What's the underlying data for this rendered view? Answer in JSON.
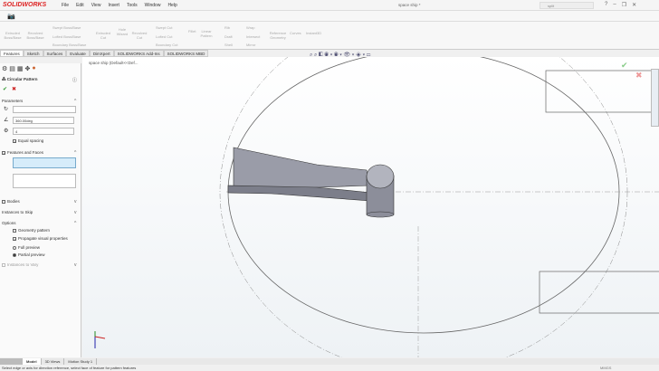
{
  "app": {
    "logo": "SOLIDWORKS",
    "doc_title": "space ship *",
    "search_value": "split"
  },
  "menu": [
    "File",
    "Edit",
    "View",
    "Insert",
    "Tools",
    "Window",
    "Help"
  ],
  "ribbon": [
    "Extruded Boss/Base",
    "Revolved Boss/Base",
    "Swept Boss/Base",
    "Lofted Boss/Base",
    "Boundary Boss/Base",
    "Extruded Cut",
    "Hole Wizard",
    "Revolved Cut",
    "Swept Cut",
    "Lofted Cut",
    "Boundary Cut",
    "Fillet",
    "Linear Pattern",
    "Rib",
    "Draft",
    "Shell",
    "Wrap",
    "Intersect",
    "Mirror",
    "Reference Geometry",
    "Curves",
    "Instant3D"
  ],
  "tabs": [
    "Features",
    "Sketch",
    "Surfaces",
    "Evaluate",
    "DimXpert",
    "SOLIDWORKS Add-Ins",
    "SOLIDWORKS MBD"
  ],
  "tree_root": "space ship (Default<<Def...",
  "panel": {
    "title": "Circular Pattern",
    "parameters": "Parameters",
    "angle": "360.00deg",
    "count": "4",
    "equal_spacing": "Equal spacing",
    "features_faces": "Features and Faces",
    "bodies": "Bodies",
    "instances_skip": "Instances to Skip",
    "options": "Options",
    "geometry_pattern": "Geometry pattern",
    "propagate": "Propagate visual properties",
    "full_preview": "Full preview",
    "partial_preview": "Partial preview",
    "instances_vary": "Instances to Vary"
  },
  "bottom_tabs": [
    "Model",
    "3D Views",
    "Motion Study 1"
  ],
  "status": {
    "message": "Select edge or axis for direction reference, select face of feature for pattern features",
    "units": "MMGS"
  },
  "colors": {
    "accent": "#d22",
    "selection": "#d6ecfa",
    "part": "#9a9ca8"
  }
}
